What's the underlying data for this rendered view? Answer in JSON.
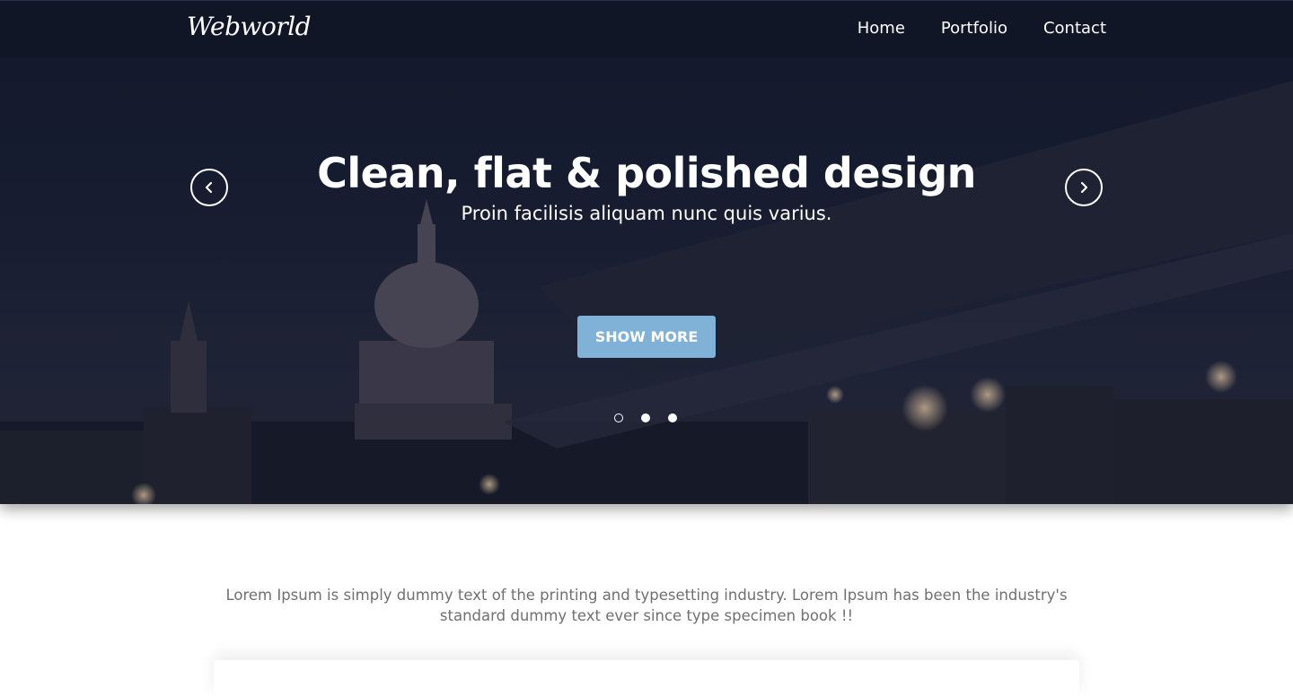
{
  "header": {
    "logo": "Webworld",
    "nav": [
      {
        "label": "Home"
      },
      {
        "label": "Portfolio"
      },
      {
        "label": "Contact"
      }
    ]
  },
  "hero": {
    "headline": "Clean, flat & polished design",
    "subheadline": "Proin facilisis aliquam nunc quis varius.",
    "cta_label": "SHOW MORE",
    "prev_icon": "chevron-left-icon",
    "next_icon": "chevron-right-icon",
    "slides": 3,
    "active_slide_index": 0
  },
  "intro": {
    "text": "Lorem Ipsum is simply dummy text of the printing and typesetting industry. Lorem Ipsum has been the industry's standard dummy text ever since type specimen book !!"
  },
  "colors": {
    "accent": "#7fb2d6",
    "hero_dark": "#1c2236",
    "body_text": "#707070"
  }
}
